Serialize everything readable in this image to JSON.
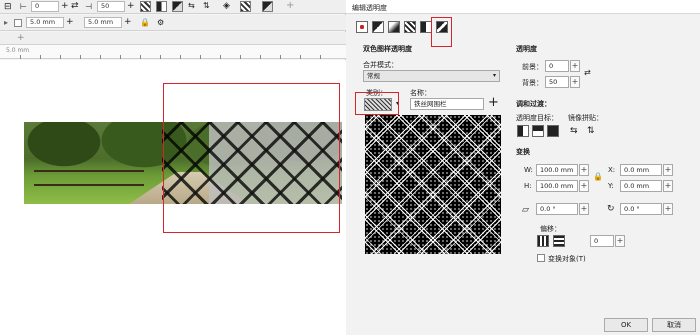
{
  "toolbar": {
    "field_a": "0",
    "field_b": "50",
    "size_w": "5.0 mm",
    "size_h": "5.0 mm",
    "ruler_unit": "5.0 mm"
  },
  "dialog": {
    "title": "编辑透明度",
    "section_title": "双色图样透明度",
    "blend_mode_label": "合并模式：",
    "blend_mode_value": "常规",
    "type_label": "类别：",
    "name_label": "名称：",
    "name_value": "铁丝网围栏",
    "add_symbol": "+",
    "transparency": {
      "heading": "透明度",
      "front_label": "前景：",
      "front_value": "0",
      "back_label": "背景：",
      "back_value": "50"
    },
    "adjust_heading": "调和过渡：",
    "target_label": "透明度目标：",
    "mirror_label": "镜像拼贴：",
    "transform": {
      "heading": "变换",
      "w_label": "W:",
      "w_value": "100.0 mm",
      "h_label": "H:",
      "h_value": "100.0 mm",
      "x_label": "X:",
      "x_value": "0.0 mm",
      "y_label": "Y:",
      "y_value": "0.0 mm",
      "skew_value": "0.0 °",
      "rotate_value": "0.0 °",
      "offset_label": "偏移：",
      "offset_value": "0",
      "transform_objects_label": "变换对象(T)"
    },
    "ok_label": "OK",
    "cancel_label": "取消"
  },
  "colors": {
    "highlight": "#d6262c"
  }
}
